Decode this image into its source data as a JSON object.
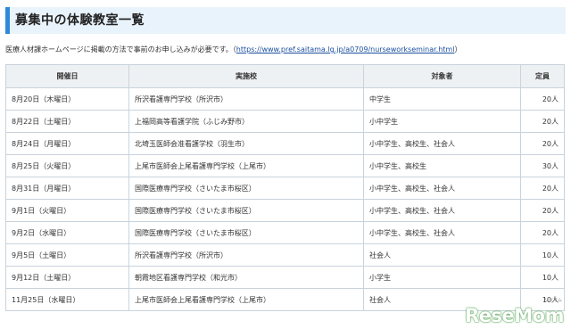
{
  "title": "募集中の体験教室一覧",
  "notice": {
    "text": "医療人材課ホームページに掲載の方法で事前のお申し込みが必要です。",
    "link_open": "（",
    "link_text": "https://www.pref.saitama.lg.jp/a0709/nurseworkseminar.html",
    "link_close": "）"
  },
  "table": {
    "headers": [
      "開催日",
      "実施校",
      "対象者",
      "定員"
    ],
    "rows": [
      [
        "8月20日（木曜日）",
        "所沢看護専門学校（所沢市）",
        "中学生",
        "20人"
      ],
      [
        "8月22日（土曜日）",
        "上福岡高等看護学院（ふじみ野市）",
        "小中学生",
        "20人"
      ],
      [
        "8月24日（月曜日）",
        "北埼玉医師会准看護学校（羽生市）",
        "小中学生、高校生、社会人",
        "20人"
      ],
      [
        "8月25日（火曜日）",
        "上尾市医師会上尾看護専門学校（上尾市）",
        "小中学生、高校生",
        "30人"
      ],
      [
        "8月31日（月曜日）",
        "国際医療専門学校（さいたま市桜区）",
        "小中学生、高校生、社会人",
        "20人"
      ],
      [
        "9月1日（火曜日）",
        "国際医療専門学校（さいたま市桜区）",
        "小中学生、高校生、社会人",
        "20人"
      ],
      [
        "9月2日（水曜日）",
        "国際医療専門学校（さいたま市桜区）",
        "小中学生、高校生、社会人",
        "20人"
      ],
      [
        "9月5日（土曜日）",
        "所沢看護専門学校（所沢市）",
        "社会人",
        "10人"
      ],
      [
        "9月12日（土曜日）",
        "朝霞地区看護専門学校（和光市）",
        "小学生",
        "10人"
      ],
      [
        "11月25日（水曜日）",
        "上尾市医師会上尾看護専門学校（上尾市）",
        "社会人",
        "10人"
      ]
    ]
  },
  "watermark": {
    "text": "ReseMom",
    "small": "リセマム"
  }
}
